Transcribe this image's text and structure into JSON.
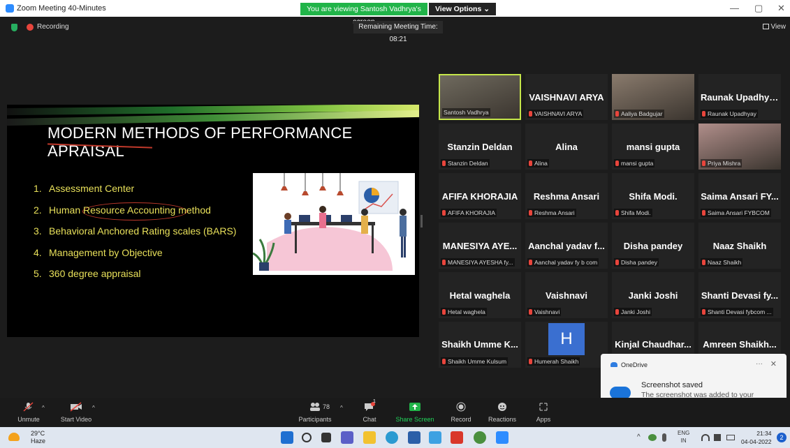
{
  "window": {
    "title": "Zoom Meeting 40-Minutes",
    "share_banner": "You are viewing Santosh Vadhrya's screen",
    "view_options": "View Options ⌄",
    "minimize": "—",
    "maximize": "▢",
    "close": "✕"
  },
  "meeting_header": {
    "recording_label": "Recording",
    "remaining_time": "Remaining Meeting Time: 08:21",
    "view_label": "View"
  },
  "slide": {
    "title": "MODERN METHODS OF PERFORMANCE APRAISAL",
    "items": [
      {
        "num": "1.",
        "text": "Assessment Center"
      },
      {
        "num": "2.",
        "text": "Human Resource Accounting method"
      },
      {
        "num": "3.",
        "text": "Behavioral Anchored Rating scales (BARS)"
      },
      {
        "num": "4.",
        "text": "Management by Objective"
      },
      {
        "num": "5.",
        "text": "360 degree appraisal"
      }
    ]
  },
  "gallery": {
    "tiles": [
      {
        "name": "",
        "label": "Santosh Vadhrya",
        "video": true,
        "active": true
      },
      {
        "name": "VAISHNAVI ARYA",
        "label": "VAISHNAVI ARYA"
      },
      {
        "name": "",
        "label": "Aaliya Badgujar",
        "video": true
      },
      {
        "name": "Raunak Upadhyay",
        "label": "Raunak Upadhyay"
      },
      {
        "name": "Stanzin Deldan",
        "label": "Stanzin Deldan"
      },
      {
        "name": "Alina",
        "label": "Alina"
      },
      {
        "name": "mansi gupta",
        "label": "mansi gupta"
      },
      {
        "name": "",
        "label": "Priya Mishra",
        "video": true
      },
      {
        "name": "AFIFA KHORAJIA",
        "label": "AFIFA KHORAJIA"
      },
      {
        "name": "Reshma Ansari",
        "label": "Reshma Ansari"
      },
      {
        "name": "Shifa Modi.",
        "label": "Shifa Modi."
      },
      {
        "name": "Saima Ansari FY...",
        "label": "Saima Ansari FYBCOM"
      },
      {
        "name": "MANESIYA AYE...",
        "label": "MANESIYA AYESHA fy..."
      },
      {
        "name": "Aanchal yadav f...",
        "label": "Aanchal yadav fy b com"
      },
      {
        "name": "Disha pandey",
        "label": "Disha pandey"
      },
      {
        "name": "Naaz Shaikh",
        "label": "Naaz Shaikh"
      },
      {
        "name": "Hetal waghela",
        "label": "Hetal waghela"
      },
      {
        "name": "Vaishnavi",
        "label": "Vaishnavi"
      },
      {
        "name": "Janki Joshi",
        "label": "Janki Joshi"
      },
      {
        "name": "Shanti Devasi fy...",
        "label": "Shanti Devasi fybcom ..."
      },
      {
        "name": "Shaikh Umme K...",
        "label": "Shaikh Umme Kulsum"
      },
      {
        "name": "",
        "label": "Humerah Shaikh",
        "avatar_letter": "H"
      },
      {
        "name": "Kinjal Chaudhar...",
        "label": ""
      },
      {
        "name": "Amreen Shaikh...",
        "label": ""
      }
    ]
  },
  "notification": {
    "app": "OneDrive",
    "more": "···",
    "close": "✕",
    "title": "Screenshot saved",
    "body": "The screenshot was added to your OneDrive."
  },
  "toolbar": {
    "unmute": "Unmute",
    "start_video": "Start Video",
    "participants": "Participants",
    "participants_count": "78",
    "chat": "Chat",
    "chat_badge": "1",
    "share_screen": "Share Screen",
    "record": "Record",
    "reactions": "Reactions",
    "apps": "Apps"
  },
  "taskbar": {
    "temperature": "29°C",
    "weather": "Haze",
    "lang_top": "ENG",
    "lang_bottom": "IN",
    "time": "21:34",
    "date": "04-04-2022",
    "notification_count": "2"
  },
  "colors": {
    "zoom_blue": "#2d8cff",
    "share_green": "#21b449",
    "slide_text_yellow": "#e8e05a",
    "record_red": "#e8453c"
  }
}
